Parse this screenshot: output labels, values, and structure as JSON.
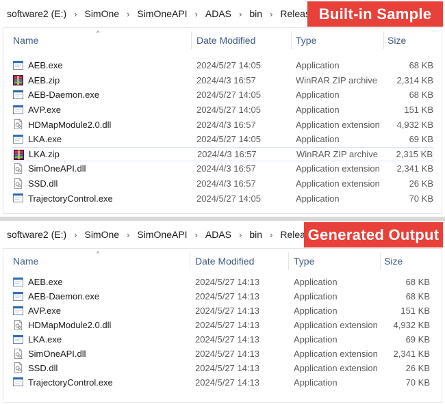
{
  "columns": {
    "name": "Name",
    "date": "Date Modified",
    "type": "Type",
    "size": "Size"
  },
  "top": {
    "badge": "Built-in Sample",
    "breadcrumb": [
      "software2 (E:)",
      "SimOne",
      "SimOneAPI",
      "ADAS",
      "bin",
      "Release"
    ],
    "files": [
      {
        "name": "AEB.exe",
        "date": "2024/5/27 14:05",
        "type": "Application",
        "size": "68 KB",
        "icon": "app-icon"
      },
      {
        "name": "AEB.zip",
        "date": "2024/4/3 16:57",
        "type": "WinRAR ZIP archive",
        "size": "2,314 KB",
        "icon": "winrar-icon"
      },
      {
        "name": "AEB-Daemon.exe",
        "date": "2024/5/27 14:05",
        "type": "Application",
        "size": "68 KB",
        "icon": "app-icon"
      },
      {
        "name": "AVP.exe",
        "date": "2024/5/27 14:05",
        "type": "Application",
        "size": "151 KB",
        "icon": "app-icon"
      },
      {
        "name": "HDMapModule2.0.dll",
        "date": "2024/4/3 16:57",
        "type": "Application extension",
        "size": "4,932 KB",
        "icon": "dll-icon"
      },
      {
        "name": "LKA.exe",
        "date": "2024/5/27 14:05",
        "type": "Application",
        "size": "69 KB",
        "icon": "app-icon"
      },
      {
        "name": "LKA.zip",
        "date": "2024/4/3 16:57",
        "type": "WinRAR ZIP archive",
        "size": "2,315 KB",
        "icon": "winrar-icon",
        "selected": true
      },
      {
        "name": "SimOneAPI.dll",
        "date": "2024/4/3 16:57",
        "type": "Application extension",
        "size": "2,341 KB",
        "icon": "dll-icon"
      },
      {
        "name": "SSD.dll",
        "date": "2024/4/3 16:57",
        "type": "Application extension",
        "size": "26 KB",
        "icon": "dll-icon"
      },
      {
        "name": "TrajectoryControl.exe",
        "date": "2024/5/27 14:05",
        "type": "Application",
        "size": "70 KB",
        "icon": "app-icon"
      }
    ]
  },
  "bottom": {
    "badge": "Generated Output",
    "breadcrumb": [
      "software2 (E:)",
      "SimOne",
      "SimOneAPI",
      "ADAS",
      "bin",
      "Release"
    ],
    "files": [
      {
        "name": "AEB.exe",
        "date": "2024/5/27 14:13",
        "type": "Application",
        "size": "68 KB",
        "icon": "app-icon"
      },
      {
        "name": "AEB-Daemon.exe",
        "date": "2024/5/27 14:13",
        "type": "Application",
        "size": "68 KB",
        "icon": "app-icon"
      },
      {
        "name": "AVP.exe",
        "date": "2024/5/27 14:13",
        "type": "Application",
        "size": "151 KB",
        "icon": "app-icon"
      },
      {
        "name": "HDMapModule2.0.dll",
        "date": "2024/5/27 14:13",
        "type": "Application extension",
        "size": "4,932 KB",
        "icon": "dll-icon"
      },
      {
        "name": "LKA.exe",
        "date": "2024/5/27 14:13",
        "type": "Application",
        "size": "69 KB",
        "icon": "app-icon"
      },
      {
        "name": "SimOneAPI.dll",
        "date": "2024/5/27 14:13",
        "type": "Application extension",
        "size": "2,341 KB",
        "icon": "dll-icon"
      },
      {
        "name": "SSD.dll",
        "date": "2024/5/27 14:13",
        "type": "Application extension",
        "size": "26 KB",
        "icon": "dll-icon"
      },
      {
        "name": "TrajectoryControl.exe",
        "date": "2024/5/27 14:13",
        "type": "Application",
        "size": "70 KB",
        "icon": "app-icon"
      }
    ]
  },
  "colors": {
    "badge": "#e8413a",
    "header_text": "#3d5a80",
    "selection_border": "#cfe0f3"
  }
}
